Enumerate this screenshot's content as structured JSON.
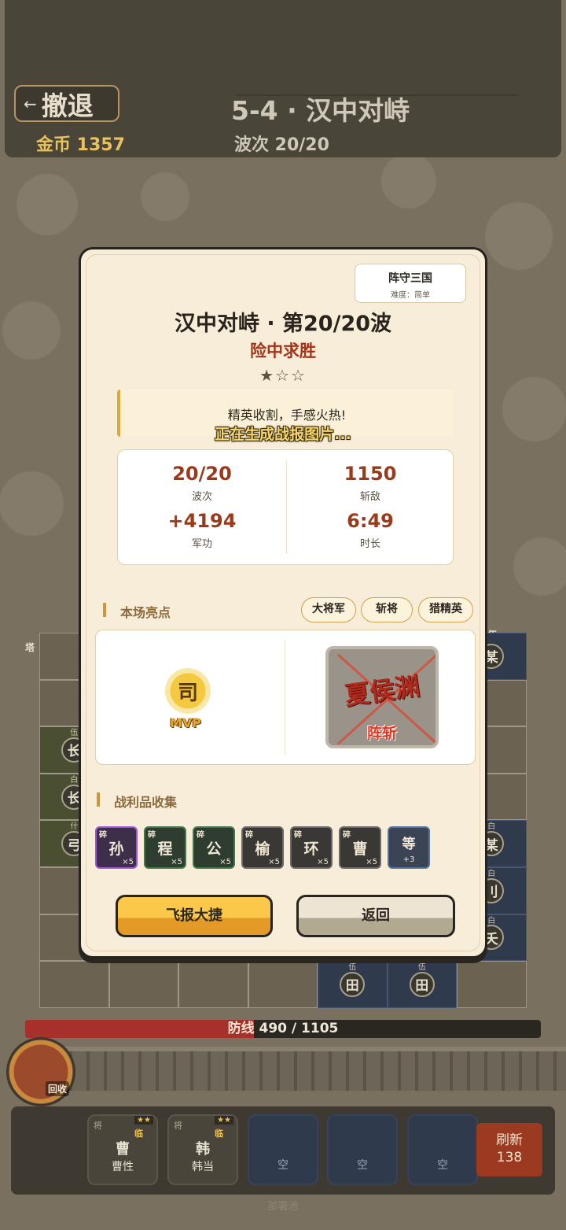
{
  "header": {
    "retreat_arrow": "←",
    "retreat_label": "撤退",
    "gold": "金币 1357",
    "stage_title": "5-4 · 汉中对峙",
    "wave": "波次 20/20"
  },
  "board": {
    "side_labels": [
      "塔",
      "伍",
      "白",
      "什",
      "伍",
      "白",
      "白"
    ],
    "cells": [
      {
        "tiny": "伍",
        "glyph": "某"
      },
      {
        "tiny": "伍",
        "glyph": "长"
      },
      {
        "tiny": "白",
        "glyph": "长"
      },
      {
        "tiny": "什",
        "glyph": "弓"
      },
      {
        "tiny": "白",
        "glyph": "某"
      },
      {
        "tiny": "白",
        "glyph": "刂"
      },
      {
        "tiny": "白",
        "glyph": "夭"
      },
      {
        "tiny": "伍",
        "glyph": "田"
      },
      {
        "tiny": "伍",
        "glyph": "田"
      }
    ]
  },
  "defense": {
    "text": "防线 490 / 1105",
    "current": 490,
    "max": 1105,
    "fill_color": "#a8302a"
  },
  "recycle_label": "回收",
  "pool": {
    "label": "部署池",
    "slots": [
      {
        "kind": "将",
        "stars": "★★",
        "tag": "临",
        "glyph": "曹",
        "name": "曹性"
      },
      {
        "kind": "将",
        "stars": "★★",
        "tag": "临",
        "glyph": "韩",
        "name": "韩当"
      },
      {
        "name": "空"
      },
      {
        "name": "空"
      },
      {
        "name": "空"
      }
    ],
    "refresh_label": "刷新",
    "refresh_cost": "138"
  },
  "modal": {
    "brand_name": "阵守三国",
    "brand_difficulty": "难度：简单",
    "title": "汉中对峙 · 第20/20波",
    "subtitle": "险中求胜",
    "stars": "★☆☆",
    "rating": {
      "earned": 1,
      "total": 3
    },
    "quote": "精英收割，手感火热!",
    "generating": "正在生成战报图片...",
    "stats": [
      {
        "value": "20/20",
        "label": "波次"
      },
      {
        "value": "1150",
        "label": "斩敌"
      },
      {
        "value": "+4194",
        "label": "军功"
      },
      {
        "value": "6:49",
        "label": "时长"
      }
    ],
    "highlights_title": "本场亮点",
    "tags": [
      "大将军",
      "斩将",
      "猎精英"
    ],
    "mvp_glyph": "司",
    "mvp_label": "MVP",
    "slain_name": "夏侯渊",
    "slain_label": "阵斩",
    "loot_title": "战利品收集",
    "loot": [
      {
        "frag": "碎",
        "glyph": "孙",
        "count": "×5",
        "rarity": "purple"
      },
      {
        "frag": "碎",
        "glyph": "程",
        "count": "×5",
        "rarity": "green"
      },
      {
        "frag": "碎",
        "glyph": "公",
        "count": "×5",
        "rarity": "green"
      },
      {
        "frag": "碎",
        "glyph": "榆",
        "count": "×5",
        "rarity": "gray"
      },
      {
        "frag": "碎",
        "glyph": "环",
        "count": "×5",
        "rarity": "gray"
      },
      {
        "frag": "碎",
        "glyph": "曹",
        "count": "×5",
        "rarity": "gray"
      },
      {
        "frag": "",
        "glyph": "等",
        "count": "+3",
        "rarity": "blue"
      }
    ],
    "share_button": "飞报大捷",
    "back_button": "返回"
  },
  "colors": {
    "accent_red": "#a23419",
    "gold": "#e9c25d",
    "panel": "#f7edd8"
  }
}
